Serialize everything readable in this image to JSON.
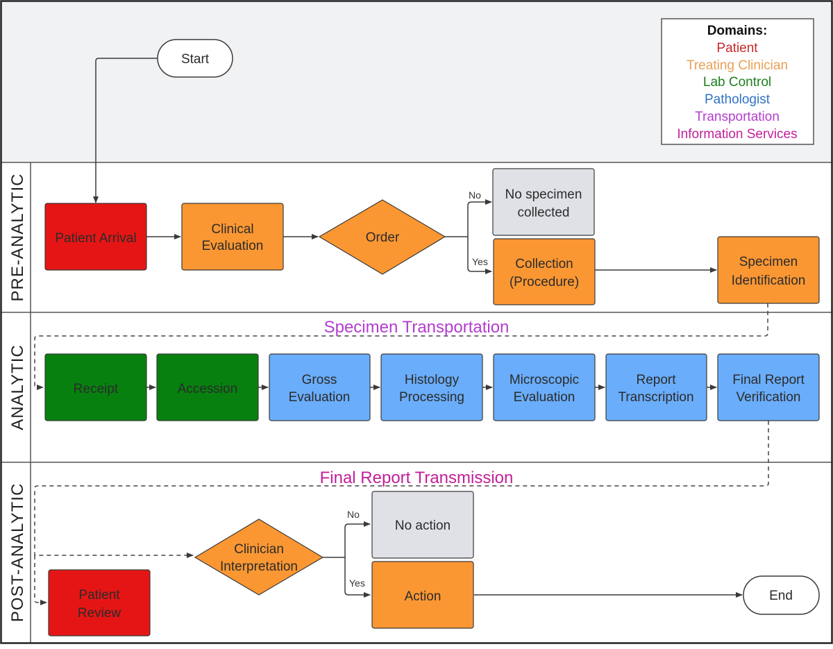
{
  "legend": {
    "title": "Domains:",
    "items": [
      {
        "label": "Patient",
        "color": "#c62828"
      },
      {
        "label": "Treating Clinician",
        "color": "#e8a055"
      },
      {
        "label": "Lab Control",
        "color": "#1e7e1e"
      },
      {
        "label": "Pathologist",
        "color": "#2f72c4"
      },
      {
        "label": "Transportation",
        "color": "#b43ccf"
      },
      {
        "label": "Information Services",
        "color": "#c21f9a"
      }
    ]
  },
  "lanes": [
    {
      "id": "pre",
      "label": "PRE-ANALYTIC"
    },
    {
      "id": "analytic",
      "label": "ANALYTIC"
    },
    {
      "id": "post",
      "label": "POST-ANALYTIC"
    }
  ],
  "colors": {
    "patient": "#e61515",
    "clinician": "#fb9733",
    "lab": "#07800f",
    "pathologist": "#6aadfa",
    "neutral": "#dfe1e6",
    "terminal": "#ffffff",
    "header_bg": "#f1f2f4",
    "transport_label": "#b43ccf",
    "info_label": "#c21f9a"
  },
  "nodes": {
    "start": "Start",
    "end": "End",
    "patient_arrival": "Patient Arrival",
    "clinical_evaluation": [
      "Clinical",
      "Evaluation"
    ],
    "order": "Order",
    "no_specimen": [
      "No specimen",
      "collected"
    ],
    "collection": [
      "Collection",
      "(Procedure)"
    ],
    "specimen_identification": [
      "Specimen",
      "Identification"
    ],
    "receipt": "Receipt",
    "accession": "Accession",
    "gross_evaluation": [
      "Gross",
      "Evaluation"
    ],
    "histology_processing": [
      "Histology",
      "Processing"
    ],
    "microscopic_evaluation": [
      "Microscopic",
      "Evaluation"
    ],
    "report_transcription": [
      "Report",
      "Transcription"
    ],
    "final_report_verification": [
      "Final Report",
      "Verification"
    ],
    "clinician_interpretation": [
      "Clinician",
      "Interpretation"
    ],
    "no_action": "No action",
    "action": "Action",
    "patient_review": [
      "Patient",
      "Review"
    ]
  },
  "branches": {
    "no": "No",
    "yes": "Yes"
  },
  "flows": {
    "specimen_transportation": "Specimen Transportation",
    "final_report_transmission": "Final Report Transmission"
  }
}
